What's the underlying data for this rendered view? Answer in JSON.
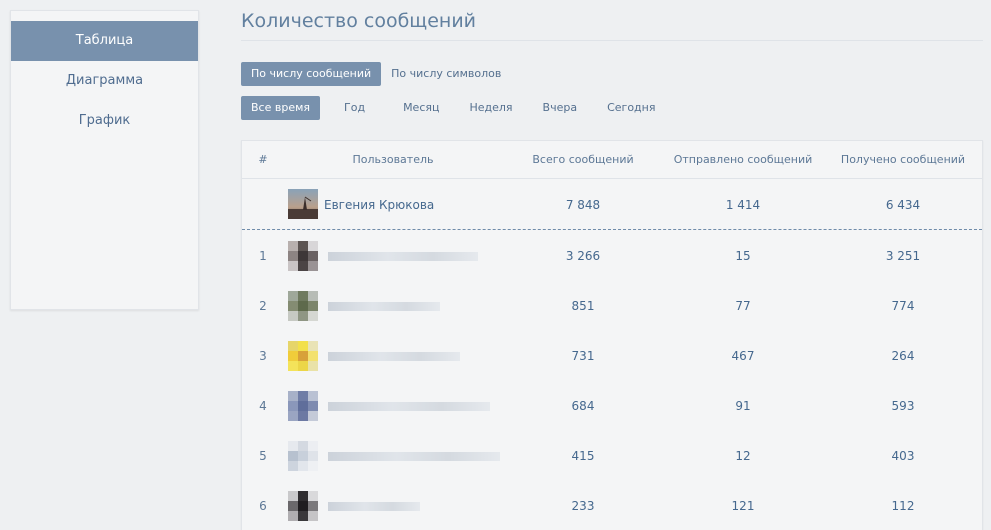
{
  "sidebar": {
    "items": [
      {
        "label": "Таблица",
        "active": true
      },
      {
        "label": "Диаграмма",
        "active": false
      },
      {
        "label": "График",
        "active": false
      }
    ]
  },
  "header": {
    "title": "Количество сообщений"
  },
  "filters": {
    "metric": [
      {
        "label": "По числу сообщений",
        "active": true
      },
      {
        "label": "По числу символов",
        "active": false
      }
    ],
    "period": [
      {
        "label": "Все время",
        "active": true
      },
      {
        "label": "Год",
        "active": false
      },
      {
        "label": "Месяц",
        "active": false
      },
      {
        "label": "Неделя",
        "active": false
      },
      {
        "label": "Вчера",
        "active": false
      },
      {
        "label": "Сегодня",
        "active": false
      }
    ]
  },
  "table": {
    "columns": [
      "#",
      "Пользователь",
      "Всего сообщений",
      "Отправлено сообщений",
      "Получено сообщений"
    ],
    "current_user": {
      "name": "Евгения Крюкова",
      "total": "7 848",
      "sent": "1 414",
      "received": "6 434"
    },
    "rows": [
      {
        "rank": "1",
        "total": "3 266",
        "sent": "15",
        "received": "3 251"
      },
      {
        "rank": "2",
        "total": "851",
        "sent": "77",
        "received": "774"
      },
      {
        "rank": "3",
        "total": "731",
        "sent": "467",
        "received": "264"
      },
      {
        "rank": "4",
        "total": "684",
        "sent": "91",
        "received": "593"
      },
      {
        "rank": "5",
        "total": "415",
        "sent": "12",
        "received": "403"
      },
      {
        "rank": "6",
        "total": "233",
        "sent": "121",
        "received": "112"
      }
    ]
  },
  "colors": {
    "accent": "#7891ad",
    "text": "#45688e",
    "background": "#eef0f2"
  }
}
